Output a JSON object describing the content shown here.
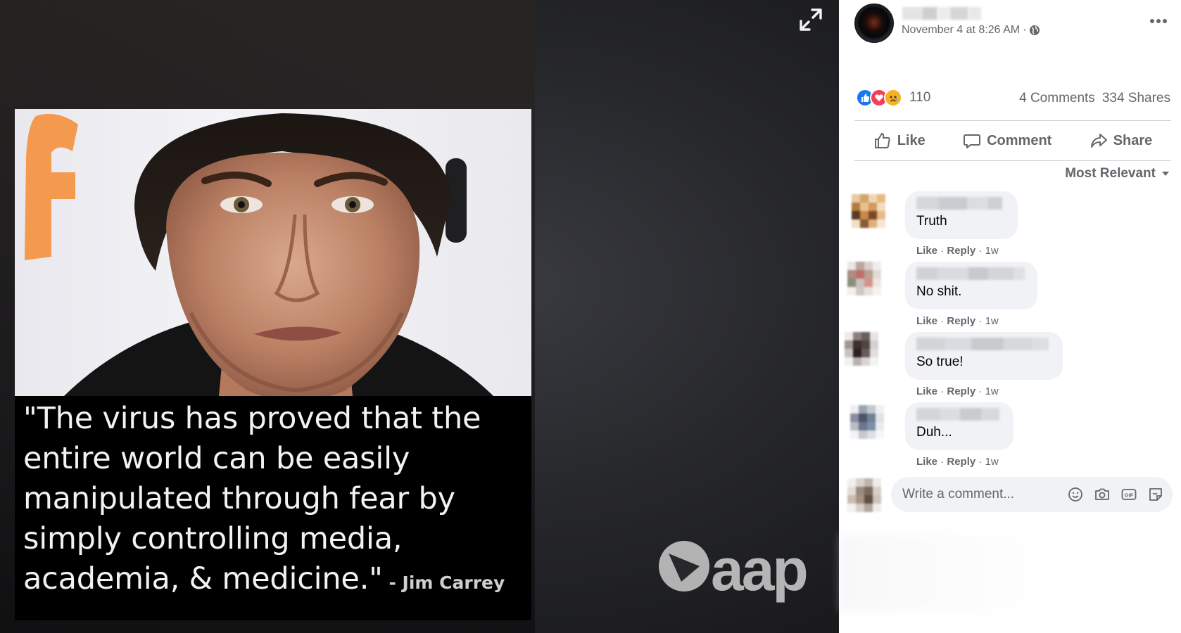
{
  "viewer": {
    "caption_lines": [
      "\"The virus has proved that the",
      "entire world can be easily",
      "manipulated through fear by",
      "simply controlling media,",
      "academia, & medicine.\""
    ],
    "author": " - Jim Carrey",
    "watermark": "aap"
  },
  "post": {
    "date": "November 4 at 8:26 AM",
    "date_separator": "·",
    "reaction_count": "110",
    "comments_count": "4 Comments",
    "shares_count": "334 Shares",
    "actions": {
      "like": "Like",
      "comment": "Comment",
      "share": "Share"
    },
    "sort_label": "Most Relevant",
    "comments": [
      {
        "text": "Truth",
        "like": "Like",
        "reply": "Reply",
        "time": "1w"
      },
      {
        "text": "No shit.",
        "like": "Like",
        "reply": "Reply",
        "time": "1w"
      },
      {
        "text": "So true!",
        "like": "Like",
        "reply": "Reply",
        "time": "1w"
      },
      {
        "text": "Duh...",
        "like": "Like",
        "reply": "Reply",
        "time": "1w"
      }
    ],
    "write_placeholder": "Write a comment...",
    "meta_separator": " · "
  },
  "colors": {
    "accent_blue": "#1877f2",
    "love_red": "#f33e58",
    "sad_yellow": "#f7b125",
    "secondary_text": "#65676b",
    "bubble_bg": "#f0f2f5"
  }
}
